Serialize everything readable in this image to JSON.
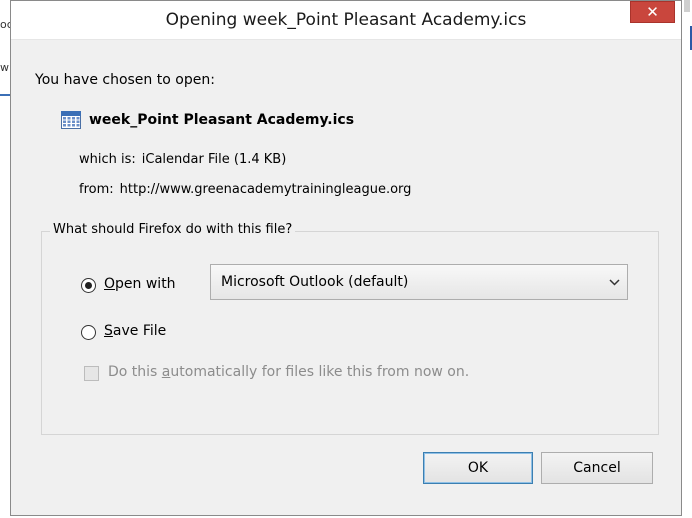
{
  "background": {
    "left_fragment_1": "oc",
    "left_fragment_2": "wi"
  },
  "dialog": {
    "title": "Opening week_Point Pleasant Academy.ics",
    "close_label": "✕",
    "accent_close": "#c9463d"
  },
  "file": {
    "chosen_text": "You have chosen to open:",
    "name": "week_Point Pleasant Academy.ics",
    "which_is_label": "which is:",
    "which_is_value": "iCalendar File (1.4 KB)",
    "from_label": "from:",
    "from_value": "http://www.greenacademytrainingleague.org",
    "icon": "calendar-icon"
  },
  "action": {
    "question": "What should Firefox do with this file?",
    "open_with_label_mnemonic": "O",
    "open_with_label_rest": "pen with",
    "open_with_selected": true,
    "app_selected": "Microsoft Outlook (default)",
    "save_label_mnemonic": "S",
    "save_label_rest": "ave File",
    "save_selected": false,
    "auto_label_prefix": "Do this ",
    "auto_label_mnemonic": "a",
    "auto_label_rest": "utomatically for files like this from now on.",
    "auto_checked": false,
    "auto_disabled": true
  },
  "buttons": {
    "ok": "OK",
    "cancel": "Cancel"
  }
}
